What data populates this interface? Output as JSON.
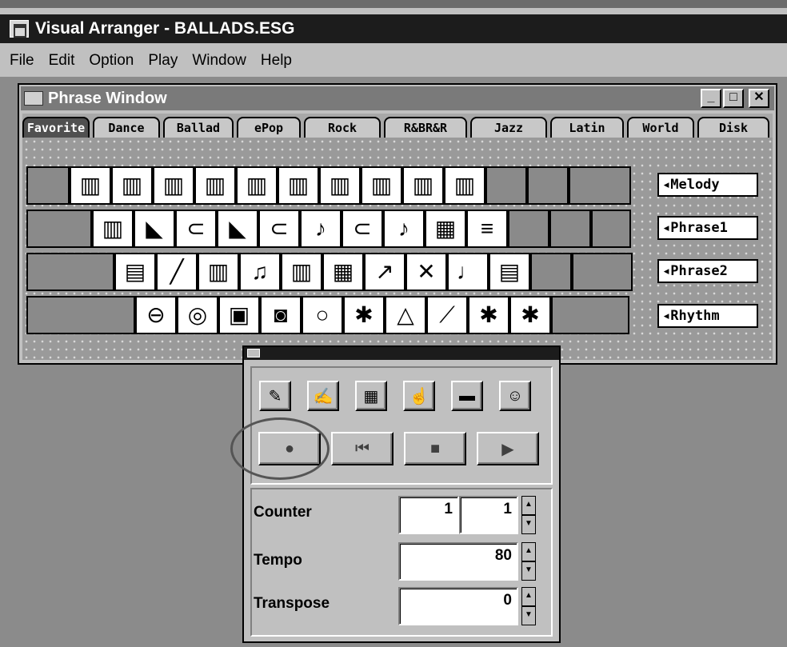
{
  "app": {
    "title": "Visual Arranger - BALLADS.ESG"
  },
  "menu": [
    "File",
    "Edit",
    "Option",
    "Play",
    "Window",
    "Help"
  ],
  "phrase_window": {
    "title": "Phrase Window",
    "minimize": "_",
    "maximize": "□",
    "close": "✕",
    "tabs": [
      "Favorite",
      "Dance",
      "Ballad",
      "ePop",
      "Rock",
      "R&BR&R",
      "Jazz",
      "Latin",
      "World",
      "Disk"
    ],
    "active_tab": "Favorite",
    "track_labels": [
      "◂Melody",
      "◂Phrase1",
      "◂Phrase2",
      "◂Rhythm"
    ],
    "rows": [
      {
        "icons": [
          "vibraphone-icon",
          "vibraphone-icon",
          "vibraphone-icon",
          "vibraphone-icon",
          "vibraphone-icon",
          "vibraphone-icon",
          "vibraphone-icon",
          "vibraphone-icon",
          "vibraphone-icon",
          "vibraphone-icon"
        ]
      },
      {
        "icons": [
          "vibraphone-icon",
          "grand-piano-icon",
          "trumpet-icon",
          "grand-piano-icon",
          "trumpet-icon",
          "saxophone-icon",
          "trumpet-icon",
          "saxophone-icon",
          "organ-icon",
          "brass-section-icon"
        ]
      },
      {
        "icons": [
          "keyboard-icon",
          "clarinet-icon",
          "vibraphone-icon",
          "violin-icon",
          "vibraphone-icon",
          "organ-icon",
          "electric-guitar-icon",
          "crossed-guitars-icon",
          "bass-guitars-icon",
          "keyboard-icon"
        ]
      },
      {
        "icons": [
          "cymbal-icon",
          "snare-drum-icon",
          "drum-kit-icon",
          "congas-icon",
          "bongos-icon",
          "drummer-icon",
          "triangle-icon",
          "maracas-icon",
          "drummer-icon",
          "drummer-icon"
        ]
      }
    ]
  },
  "control_panel": {
    "tools": [
      "note-input-icon",
      "score-edit-icon",
      "grid-icon",
      "hand-pointer-icon",
      "keyboard-icon",
      "smiley-icon"
    ],
    "transport": [
      "record-button",
      "rewind-button",
      "stop-button",
      "play-button"
    ],
    "counter": {
      "label": "Counter",
      "measure": "1",
      "beat": "1"
    },
    "tempo": {
      "label": "Tempo",
      "value": "80"
    },
    "transpose": {
      "label": "Transpose",
      "value": "0"
    }
  }
}
